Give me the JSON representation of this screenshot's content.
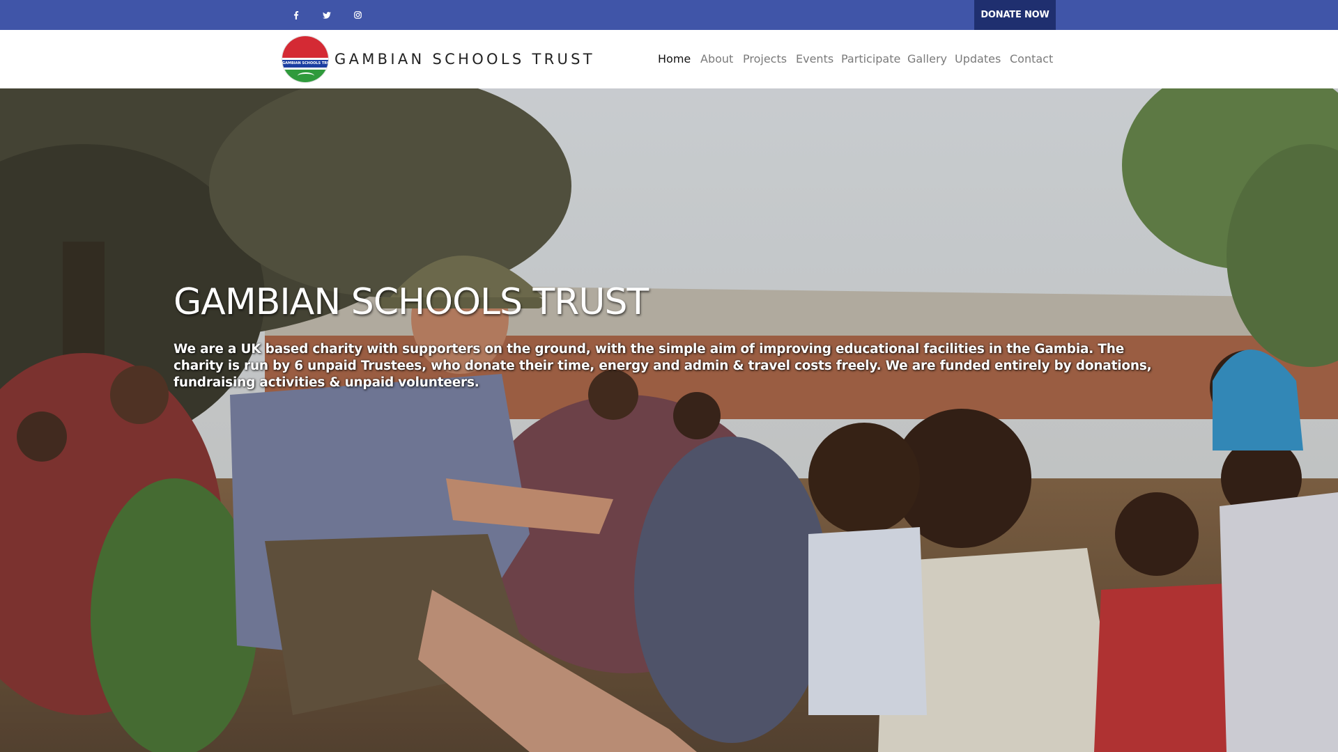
{
  "topbar": {
    "social_icons": [
      "facebook-icon",
      "twitter-icon",
      "instagram-icon"
    ],
    "donate_label": "DONATE NOW",
    "colors": {
      "bar": "#4055a8",
      "donate": "#1f2f6f"
    }
  },
  "header": {
    "logo_text": "GAMBIAN SCHOOLS TRUST",
    "site_title": "GAMBIAN SCHOOLS TRUST",
    "nav": [
      {
        "label": "Home",
        "active": true
      },
      {
        "label": "About",
        "active": false
      },
      {
        "label": "Projects",
        "active": false
      },
      {
        "label": "Events",
        "active": false
      },
      {
        "label": "Participate",
        "active": false
      },
      {
        "label": "Gallery",
        "active": false
      },
      {
        "label": "Updates",
        "active": false
      },
      {
        "label": "Contact",
        "active": false
      }
    ]
  },
  "hero": {
    "title": "GAMBIAN SCHOOLS TRUST",
    "text": "We are a UK based charity with supporters on the ground, with the simple aim of improving educational facilities in the Gambia. The charity is run by 6 unpaid Trustees, who donate their time, energy and admin & travel costs freely. We are funded entirely by donations, fundraising activities & unpaid volunteers."
  }
}
